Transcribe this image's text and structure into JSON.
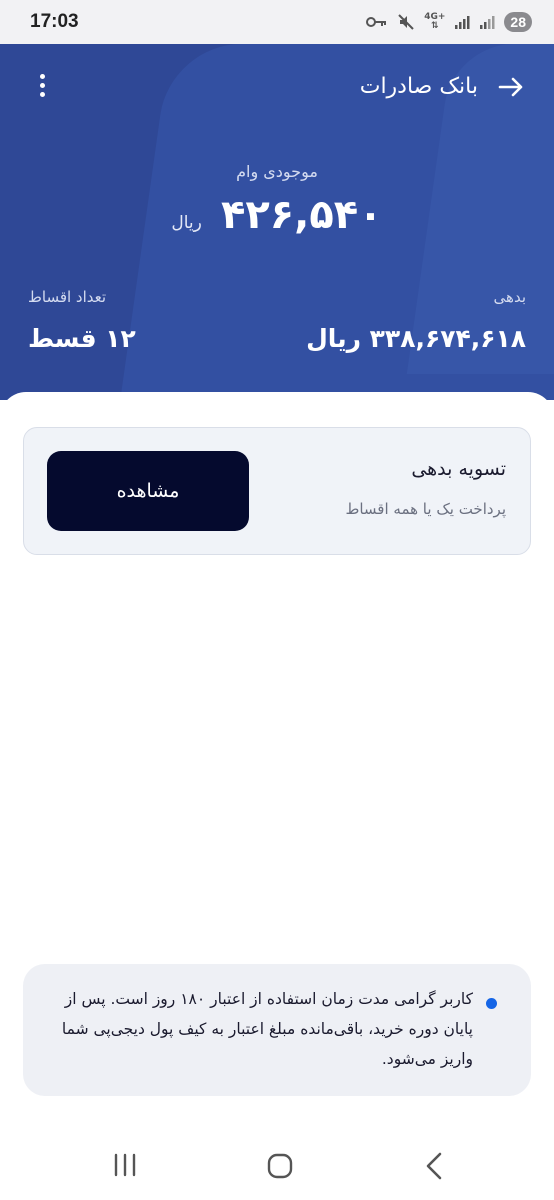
{
  "status_bar": {
    "time": "17:03",
    "battery": "28",
    "network": "4G+",
    "icons": [
      "key-icon",
      "mute-icon",
      "signal-icon",
      "signal-icon",
      "battery-icon"
    ]
  },
  "header": {
    "title": "بانک صادرات",
    "back_icon": "arrow-right-icon",
    "menu_icon": "more-vertical-icon"
  },
  "loan": {
    "label": "موجودی وام",
    "amount": "۴۲۶,۵۴۰",
    "unit": "ریال"
  },
  "debt": {
    "label": "بدهی",
    "value": "۳۳۸,۶۷۴,۶۱۸ ریال"
  },
  "installments": {
    "label": "تعداد اقساط",
    "value": "۱۲ قسط"
  },
  "settle_card": {
    "title": "تسویه بدهی",
    "subtitle": "پرداخت یک یا همه اقساط",
    "button_label": "مشاهده"
  },
  "notice": {
    "text": "کاربر گرامی مدت زمان استفاده از اعتبار ۱۸۰ روز است. پس از پایان دوره خرید، باقی‌مانده مبلغ اعتبار به کیف پول دیجی‌پی شما واریز می‌شود."
  },
  "colors": {
    "hero_bg": "#2f4896",
    "button_bg": "#050a2e",
    "accent_dot": "#1565e6"
  }
}
